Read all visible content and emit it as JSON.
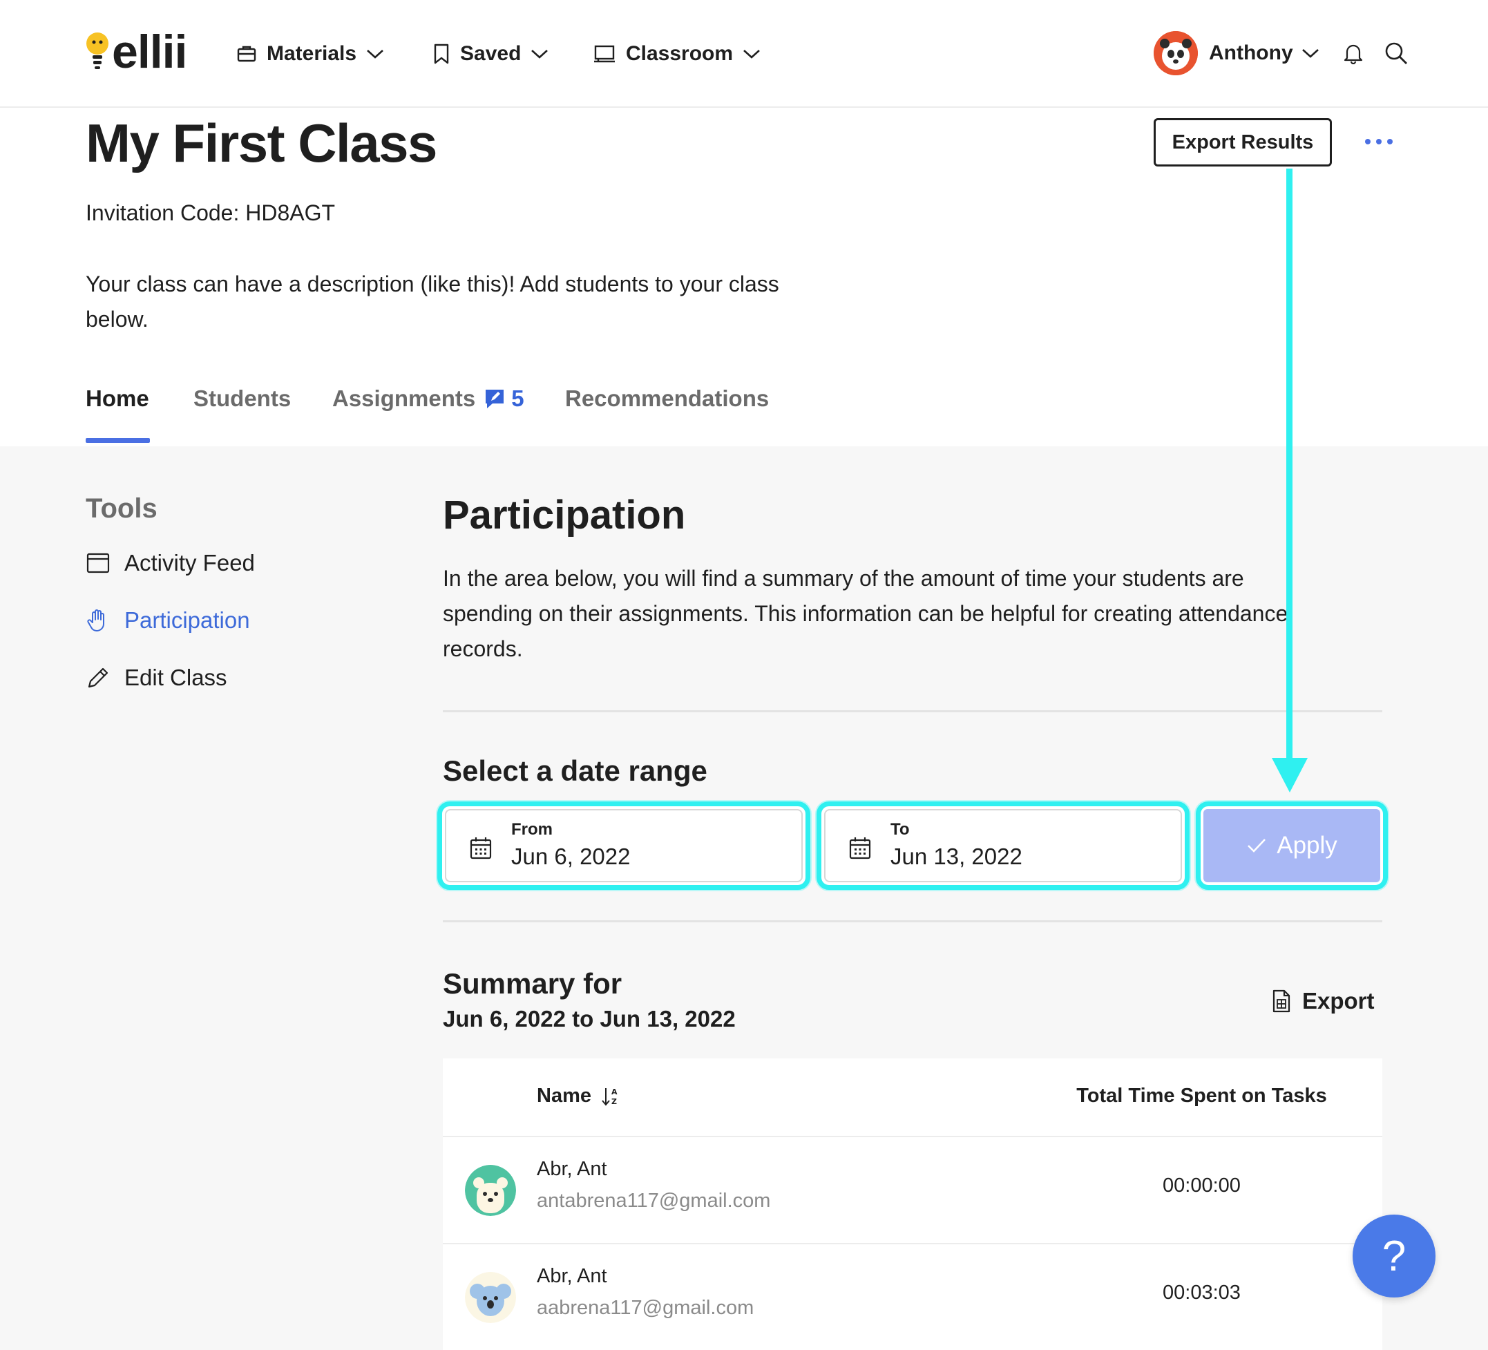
{
  "nav": {
    "logo": "ellii",
    "items": [
      {
        "label": "Materials",
        "icon": "briefcase-icon"
      },
      {
        "label": "Saved",
        "icon": "bookmark-icon"
      },
      {
        "label": "Classroom",
        "icon": "classroom-icon"
      }
    ],
    "user": {
      "name": "Anthony"
    }
  },
  "class": {
    "title": "My First Class",
    "invitation": "Invitation Code: HD8AGT",
    "description": "Your class can have a description (like this)! Add students to your class below.",
    "export_results": "Export Results"
  },
  "tabs": [
    {
      "label": "Home",
      "active": true
    },
    {
      "label": "Students"
    },
    {
      "label": "Assignments",
      "count": "5"
    },
    {
      "label": "Recommendations"
    }
  ],
  "tools": {
    "title": "Tools",
    "items": [
      {
        "label": "Activity Feed",
        "icon": "calendar-window-icon"
      },
      {
        "label": "Participation",
        "icon": "hand-icon",
        "active": true
      },
      {
        "label": "Edit Class",
        "icon": "pencil-icon"
      }
    ]
  },
  "participation": {
    "title": "Participation",
    "description": "In the area below, you will find a summary of the amount of time your students are spending on their assignments. This information can be helpful for creating attendance records.",
    "range_title": "Select a date range",
    "from": {
      "label": "From",
      "value": "Jun 6, 2022"
    },
    "to": {
      "label": "To",
      "value": "Jun 13, 2022"
    },
    "apply": "Apply",
    "summary_title": "Summary for",
    "summary_range": "Jun 6, 2022 to Jun 13, 2022",
    "export": "Export"
  },
  "table": {
    "columns": [
      "Name",
      "Total Time Spent on Tasks"
    ],
    "rows": [
      {
        "name": "Abr, Ant",
        "email": "antabrena117@gmail.com",
        "time": "00:00:00",
        "avatar": "bear-icon"
      },
      {
        "name": "Abr, Ant",
        "email": "aabrena117@gmail.com",
        "time": "00:03:03",
        "avatar": "koala-icon"
      }
    ]
  },
  "help": {
    "label": "?"
  },
  "colors": {
    "accent": "#4a6fe3",
    "highlight": "#2ff0f0",
    "apply_bg": "#a9b8f5",
    "help_bg": "#4a7ae8"
  }
}
